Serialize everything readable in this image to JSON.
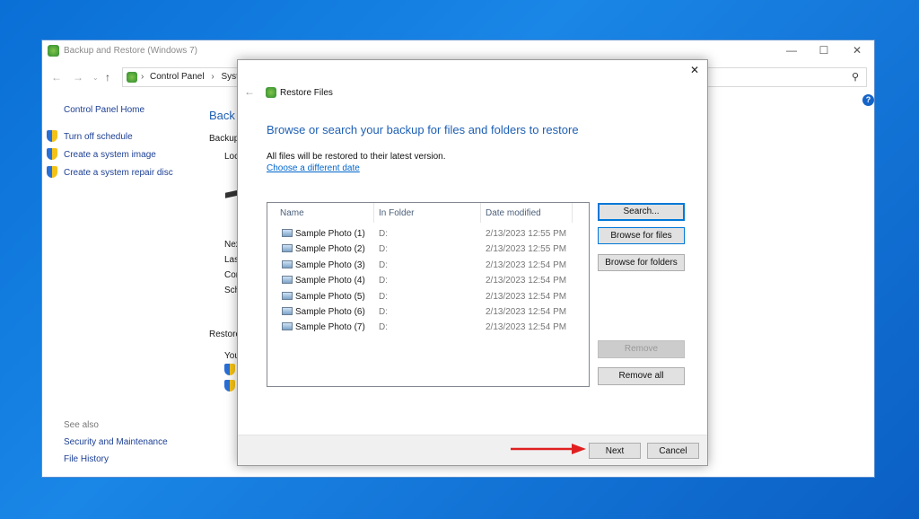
{
  "window": {
    "title": "Backup and Restore (Windows 7)",
    "breadcrumb": [
      "Control Panel",
      "Syst"
    ],
    "sidebar": {
      "home": "Control Panel Home",
      "tasks": [
        "Turn off schedule",
        "Create a system image",
        "Create a system repair disc"
      ],
      "see_also": "See also",
      "links": [
        "Security and Maintenance",
        "File History"
      ]
    },
    "main": {
      "heading": "Back",
      "backup": "Backup",
      "loc": "Loc",
      "next": "Nex",
      "last": "Las",
      "con": "Con",
      "sch": "Sch",
      "restore": "Restore",
      "you": "You"
    }
  },
  "dialog": {
    "title": "Restore Files",
    "heading": "Browse or search your backup for files and folders to restore",
    "info": "All files will be restored to their latest version.",
    "date_link": "Choose a different date",
    "columns": [
      "Name",
      "In Folder",
      "Date modified"
    ],
    "files": [
      {
        "name": "Sample Photo (1)",
        "folder": "D:",
        "date": "2/13/2023 12:55 PM"
      },
      {
        "name": "Sample Photo (2)",
        "folder": "D:",
        "date": "2/13/2023 12:55 PM"
      },
      {
        "name": "Sample Photo (3)",
        "folder": "D:",
        "date": "2/13/2023 12:54 PM"
      },
      {
        "name": "Sample Photo (4)",
        "folder": "D:",
        "date": "2/13/2023 12:54 PM"
      },
      {
        "name": "Sample Photo (5)",
        "folder": "D:",
        "date": "2/13/2023 12:54 PM"
      },
      {
        "name": "Sample Photo (6)",
        "folder": "D:",
        "date": "2/13/2023 12:54 PM"
      },
      {
        "name": "Sample Photo (7)",
        "folder": "D:",
        "date": "2/13/2023 12:54 PM"
      }
    ],
    "buttons": {
      "search": "Search...",
      "browse_files": "Browse for files",
      "browse_folders": "Browse for folders",
      "remove": "Remove",
      "remove_all": "Remove all",
      "next": "Next",
      "cancel": "Cancel"
    }
  },
  "colors": {
    "accent": "#0078d7",
    "annotation_arrow": "#e02020"
  }
}
